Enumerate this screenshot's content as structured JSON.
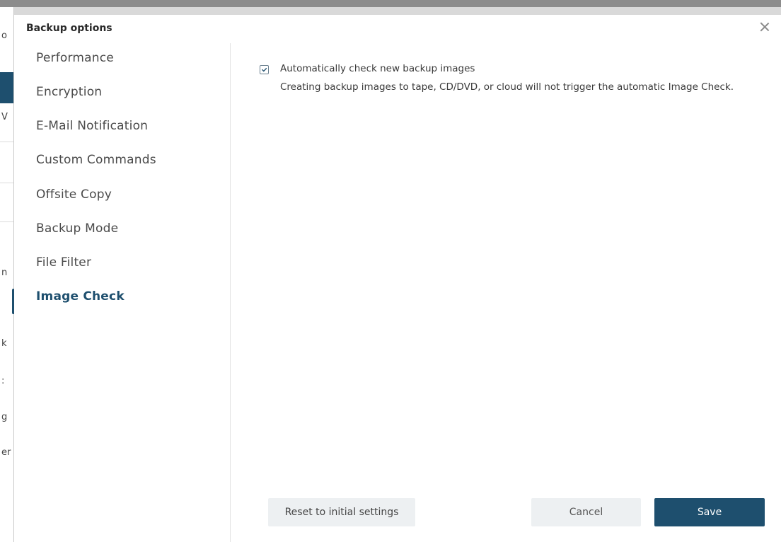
{
  "dialog": {
    "title": "Backup options"
  },
  "sidebar": {
    "items": [
      {
        "label": "Performance",
        "active": false
      },
      {
        "label": "Encryption",
        "active": false
      },
      {
        "label": "E-Mail Notification",
        "active": false
      },
      {
        "label": "Custom Commands",
        "active": false
      },
      {
        "label": "Offsite Copy",
        "active": false
      },
      {
        "label": "Backup Mode",
        "active": false
      },
      {
        "label": "File Filter",
        "active": false
      },
      {
        "label": "Image Check",
        "active": true
      }
    ]
  },
  "content": {
    "option": {
      "label": "Automatically check new backup images",
      "checked": true,
      "description": "Creating backup images to tape, CD/DVD, or cloud will not trigger the automatic Image Check."
    }
  },
  "buttons": {
    "reset": "Reset to initial settings",
    "cancel": "Cancel",
    "save": "Save"
  },
  "background_fragments": [
    "o",
    "V",
    "n",
    "k",
    ":",
    "g",
    "er"
  ],
  "colors": {
    "accent": "#1e4f6e",
    "button_bg": "#edf0f2"
  },
  "icons": {
    "close": "close-icon",
    "check": "check-icon"
  }
}
